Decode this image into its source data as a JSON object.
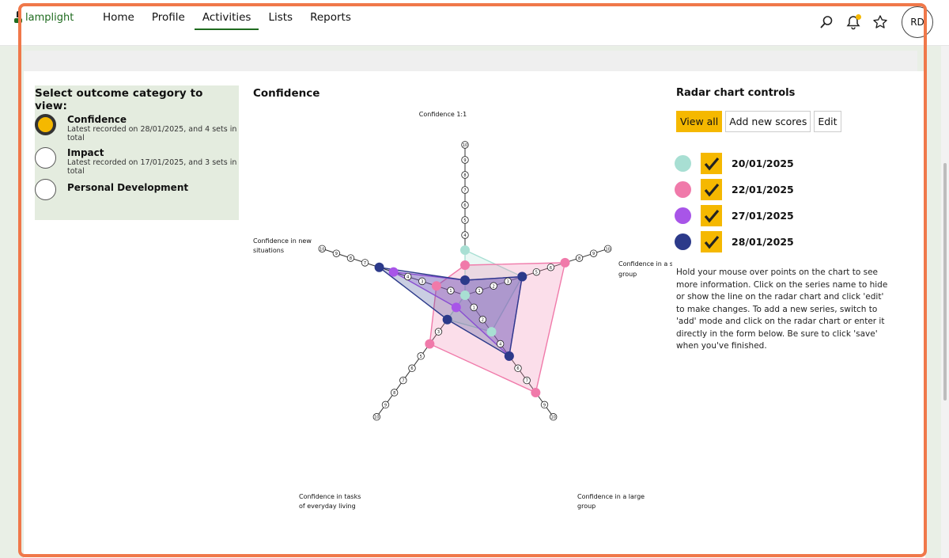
{
  "app": {
    "logo_text": "lamplight"
  },
  "nav": [
    {
      "label": "Home",
      "active": false
    },
    {
      "label": "Profile",
      "active": false
    },
    {
      "label": "Activities",
      "active": true
    },
    {
      "label": "Lists",
      "active": false
    },
    {
      "label": "Reports",
      "active": false
    }
  ],
  "top_icons": [
    "search-icon",
    "bell-icon",
    "star-icon"
  ],
  "user": {
    "initials": "RD"
  },
  "categories": {
    "title": "Select outcome category to view:",
    "items": [
      {
        "name": "Confidence",
        "sub": "Latest recorded on 28/01/2025, and 4 sets in total",
        "selected": true
      },
      {
        "name": "Impact",
        "sub": "Latest recorded on 17/01/2025, and 3 sets in total",
        "selected": false
      },
      {
        "name": "Personal Development",
        "sub": "",
        "selected": false
      }
    ]
  },
  "chart": {
    "title": "Confidence"
  },
  "chart_data": {
    "type": "radar",
    "axes": [
      "Confidence 1:1",
      "Confidence in a small group",
      "Confidence in a large group",
      "Confidence in tasks of everyday living",
      "Confidence in new situations"
    ],
    "axis_labels": {
      "a0": "Confidence 1:1",
      "a1": "Confidence in a sm",
      "a1b": "group",
      "a2": "Confidence in a large",
      "a2b": "group",
      "a3": "Confidence in tasks",
      "a3b": "of everyday living",
      "a4": "Confidence in new",
      "a4b": "situations"
    },
    "range": [
      0,
      10
    ],
    "ticks": [
      "1",
      "2",
      "3",
      "4",
      "5",
      "6",
      "7",
      "8",
      "9",
      "10"
    ],
    "series": [
      {
        "name": "20/01/2025",
        "color": "#a8dfd3",
        "values": [
          3,
          4,
          3,
          2,
          0
        ]
      },
      {
        "name": "22/01/2025",
        "color": "#f07aaa",
        "values": [
          2,
          7,
          8,
          4,
          2
        ]
      },
      {
        "name": "27/01/2025",
        "color": "#a855e8",
        "values": [
          1,
          4,
          5,
          1,
          5
        ]
      },
      {
        "name": "28/01/2025",
        "color": "#2c3a8a",
        "values": [
          1,
          4,
          5,
          2,
          6
        ]
      }
    ]
  },
  "controls": {
    "title": "Radar chart controls",
    "buttons": {
      "view_all": "View all",
      "add_new": "Add new scores",
      "edit": "Edit"
    },
    "help": "Hold your mouse over points on the chart to see more information. Click on the series name to hide or show the line on the radar chart and click 'edit' to make changes. To add a new series, switch to 'add' mode and click on the radar chart or enter it directly in the form below. Be sure to click 'save' when you've finished."
  },
  "colors": {
    "accent": "#f5b800",
    "brand": "#1f6b1f",
    "panel": "#e4ecdf",
    "frame": "#f0784a"
  }
}
